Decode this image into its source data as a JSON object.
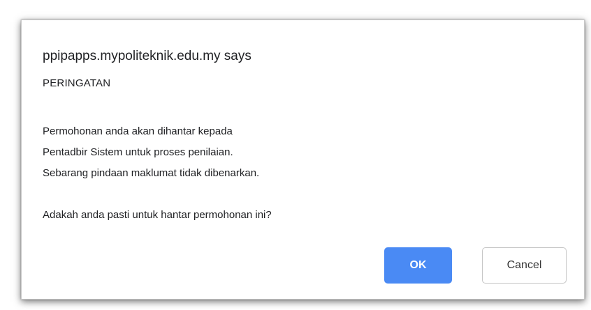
{
  "dialog": {
    "title": "ppipapps.mypoliteknik.edu.my says",
    "subtitle": "PERINGATAN",
    "message_lines": [
      "Permohonan anda akan dihantar kepada",
      "Pentadbir Sistem untuk proses penilaian.",
      "Sebarang pindaan maklumat tidak dibenarkan."
    ],
    "question": "Adakah anda pasti untuk hantar permohonan ini?",
    "ok_label": "OK",
    "cancel_label": "Cancel"
  },
  "colors": {
    "ok_button": "#4a8af4",
    "text": "#202124"
  }
}
